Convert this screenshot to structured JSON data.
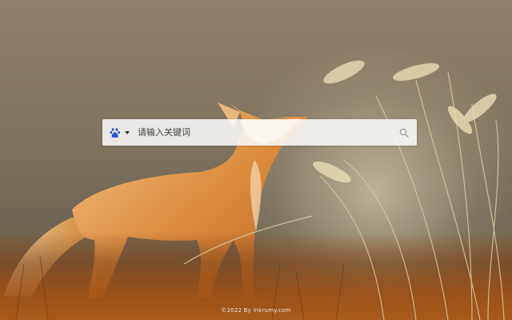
{
  "search": {
    "placeholder": "请输入关键词",
    "engine_icon": "baidu-paw-icon",
    "search_icon": "magnifier-icon"
  },
  "footer": {
    "copyright": "©2022 By inkrumy.com"
  },
  "colors": {
    "engine_blue": "#2f55d4",
    "search_bar": "#fcfcfc",
    "text": "#333333"
  }
}
